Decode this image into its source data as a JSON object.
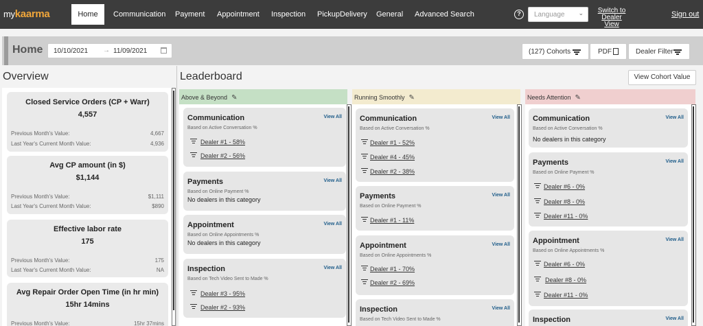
{
  "brand": {
    "prefix": "my",
    "name": "kaarma"
  },
  "nav": {
    "home": "Home",
    "communication": "Communication",
    "payment": "Payment",
    "appointment": "Appointment",
    "inspection": "Inspection",
    "pickup": "PickupDelivery",
    "general": "General",
    "advanced": "Advanced Search",
    "help": "?",
    "language_placeholder": "Language",
    "switch_line1": "Switch to",
    "switch_line2": "Dealer View",
    "signout": "Sign out"
  },
  "header": {
    "title": "Home",
    "date_from": "10/10/2021",
    "date_arrow": "→",
    "date_to": "11/09/2021",
    "cohorts_label": "(127) Cohorts",
    "pdf_label": "PDF",
    "dealer_filter_label": "Dealer Filter"
  },
  "overview": {
    "title": "Overview",
    "cards": [
      {
        "title": "Closed Service Orders (CP + Warr)",
        "value": "4,557",
        "prev_label": "Previous Month's Value:",
        "prev_value": "4,667",
        "last_label": "Last Year's Current Month Value:",
        "last_value": "4,936"
      },
      {
        "title": "Avg CP amount (in $)",
        "value": "$1,144",
        "prev_label": "Previous Month's Value:",
        "prev_value": "$1,111",
        "last_label": "Last Year's Current Month Value:",
        "last_value": "$890"
      },
      {
        "title": "Effective labor rate",
        "value": "175",
        "prev_label": "Previous Month's Value:",
        "prev_value": "175",
        "last_label": "Last Year's Current Month Value:",
        "last_value": "NA"
      },
      {
        "title": "Avg Repair Order Open Time (in hr min)",
        "value": "15hr 14mins",
        "prev_label": "Previous Month's Value:",
        "prev_value": "15hr 37mins"
      }
    ]
  },
  "leaderboard": {
    "title": "Leaderboard",
    "view_cohort_label": "View Cohort Value",
    "view_all": "View All",
    "columns": [
      {
        "name": "Above & Beyond",
        "color": "#c5e0c5",
        "cards": [
          {
            "title": "Communication",
            "subtitle": "Based on Active Conversation %",
            "rows": [
              "Dealer #1 - 58%",
              "Dealer #2 - 56%"
            ]
          },
          {
            "title": "Payments",
            "subtitle": "Based on Online Payment %",
            "empty": "No dealers in this category"
          },
          {
            "title": "Appointment",
            "subtitle": "Based on Online Appointments %",
            "empty": "No dealers in this category"
          },
          {
            "title": "Inspection",
            "subtitle": "Based on Tech Video Sent to Made %",
            "rows": [
              "Dealer #3 - 95%",
              "Dealer #2 - 93%"
            ]
          }
        ]
      },
      {
        "name": "Running Smoothly",
        "color": "#f3ebcf",
        "cards": [
          {
            "title": "Communication",
            "subtitle": "Based on Active Conversation %",
            "rows": [
              "Dealer #1 - 52%",
              "Dealer #4 - 45%",
              "Dealer #2 - 38%"
            ]
          },
          {
            "title": "Payments",
            "subtitle": "Based on Online Payment %",
            "rows": [
              "Dealer #1 - 11%"
            ]
          },
          {
            "title": "Appointment",
            "subtitle": "Based on Online Appointments %",
            "rows": [
              "Dealer #1 - 70%",
              "Dealer #2 - 69%"
            ]
          },
          {
            "title": "Inspection",
            "subtitle": "Based on Tech Video Sent to Made %"
          }
        ]
      },
      {
        "name": "Needs Attention",
        "color": "#f0cfcf",
        "cards": [
          {
            "title": "Communication",
            "subtitle": "Based on Active Conversation %",
            "empty": "No dealers in this category"
          },
          {
            "title": "Payments",
            "subtitle": "Based on Online Payment %",
            "rows": [
              "Dealer #6 - 0%",
              "Dealer #8 - 0%",
              "Dealer #11 - 0%"
            ]
          },
          {
            "title": "Appointment",
            "subtitle": "Based on Online Appointments %",
            "rows": [
              "Dealer #6 - 0%",
              "Dealer #8 - 0%",
              "Dealer #11 - 0%"
            ]
          },
          {
            "title": "Inspection"
          }
        ]
      }
    ]
  }
}
